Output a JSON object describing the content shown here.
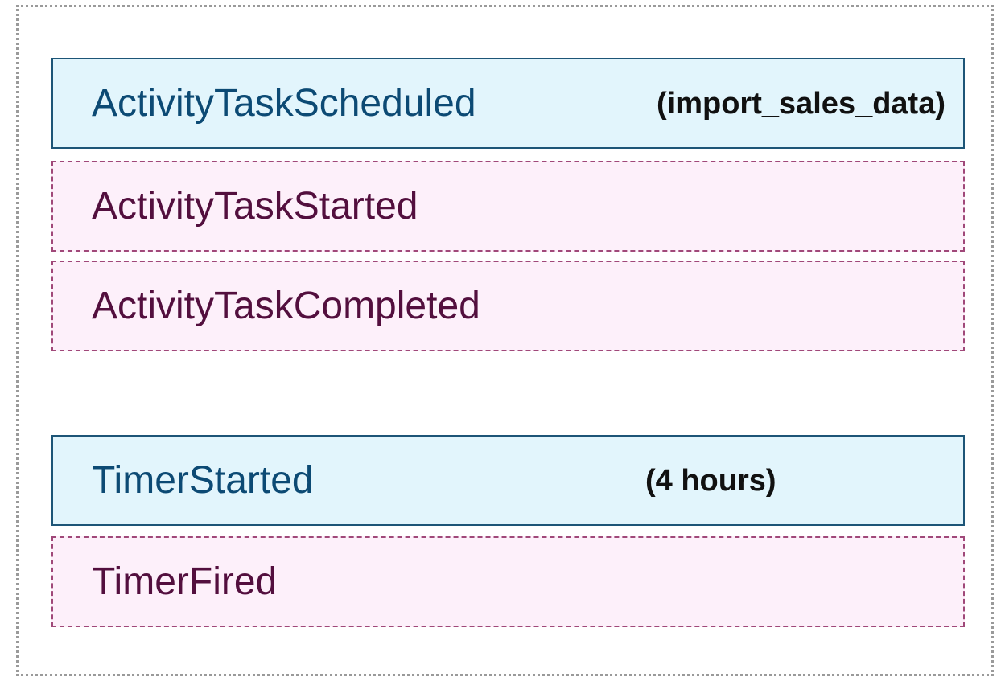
{
  "activity_group": {
    "scheduled": {
      "label": "ActivityTaskScheduled",
      "param": "(import_sales_data)"
    },
    "started": {
      "label": "ActivityTaskStarted"
    },
    "completed": {
      "label": "ActivityTaskCompleted"
    }
  },
  "timer_group": {
    "started": {
      "label": "TimerStarted",
      "param": "(4 hours)"
    },
    "fired": {
      "label": "TimerFired"
    }
  },
  "colors": {
    "command_fill": "#e2f5fc",
    "command_border": "#1d5577",
    "command_text": "#0c4a74",
    "event_fill": "#fdf0fa",
    "event_border": "#a04879",
    "event_text": "#530f3e",
    "outer_border": "#9a9a9a"
  }
}
